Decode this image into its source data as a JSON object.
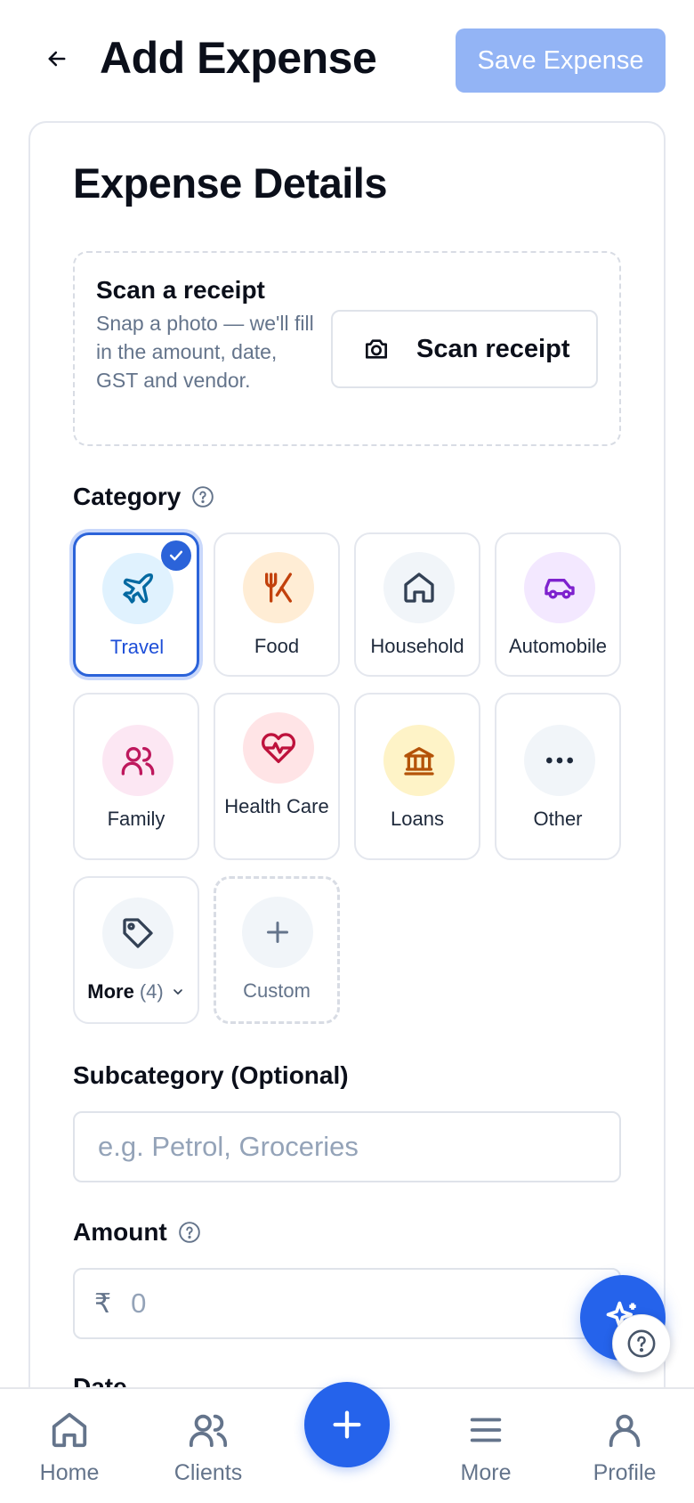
{
  "header": {
    "title": "Add Expense",
    "save_label": "Save Expense"
  },
  "card": {
    "title": "Expense Details"
  },
  "scan": {
    "title": "Scan a receipt",
    "description": "Snap a photo — we'll fill in the amount, date, GST and vendor.",
    "button_label": "Scan receipt"
  },
  "category": {
    "label": "Category",
    "items": [
      {
        "label": "Travel",
        "icon": "plane-icon",
        "selected": true
      },
      {
        "label": "Food",
        "icon": "utensils-icon"
      },
      {
        "label": "Household",
        "icon": "home-icon"
      },
      {
        "label": "Automobile",
        "icon": "car-icon"
      },
      {
        "label": "Family",
        "icon": "users-icon"
      },
      {
        "label": "Health Care",
        "icon": "heart-pulse-icon"
      },
      {
        "label": "Loans",
        "icon": "bank-icon"
      },
      {
        "label": "Other",
        "icon": "more-dots-icon"
      }
    ],
    "more_label": "More",
    "more_count": "(4)",
    "custom_label": "Custom"
  },
  "subcategory": {
    "label": "Subcategory (Optional)",
    "placeholder": "e.g. Petrol, Groceries"
  },
  "amount": {
    "label": "Amount",
    "currency": "₹",
    "value": "0"
  },
  "date": {
    "label": "Date"
  },
  "nav": {
    "items": [
      {
        "label": "Home",
        "icon": "home-icon"
      },
      {
        "label": "Clients",
        "icon": "users-icon"
      },
      {
        "label": "More",
        "icon": "menu-icon"
      },
      {
        "label": "Profile",
        "icon": "user-icon"
      }
    ]
  },
  "colors": {
    "primary": "#2563eb",
    "save_disabled": "#93b4f5"
  }
}
